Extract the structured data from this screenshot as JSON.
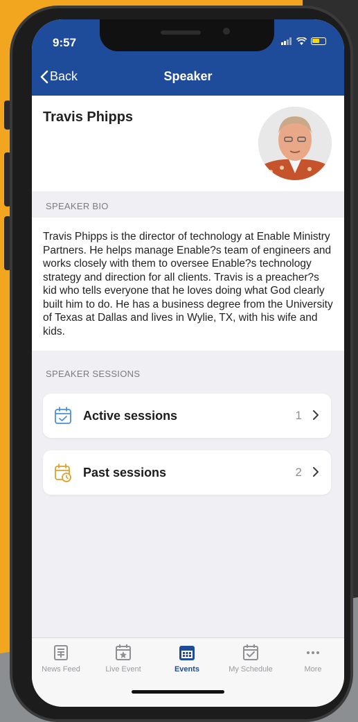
{
  "status": {
    "time": "9:57"
  },
  "nav": {
    "back": "Back",
    "title": "Speaker"
  },
  "speaker": {
    "name": "Travis Phipps",
    "bio_label": "SPEAKER BIO",
    "bio": "Travis Phipps is the director of technology at Enable Ministry Partners. He helps manage Enable?s team of engineers and works closely with them to oversee Enable?s technology strategy and direction for all clients. Travis is a preacher?s kid who tells everyone that he loves doing what God clearly built him to do. He has a business degree from the University of Texas at Dallas and lives in Wylie, TX, with his wife and kids.",
    "sessions_label": "SPEAKER SESSIONS"
  },
  "sessions": {
    "active": {
      "label": "Active sessions",
      "count": "1",
      "icon": "calendar-check-icon",
      "color": "#4a90d9"
    },
    "past": {
      "label": "Past sessions",
      "count": "2",
      "icon": "calendar-clock-icon",
      "color": "#e2a02a"
    }
  },
  "tabs": [
    {
      "label": "News Feed",
      "icon": "newspaper-icon"
    },
    {
      "label": "Live Event",
      "icon": "calendar-star-icon"
    },
    {
      "label": "Events",
      "icon": "calendar-grid-icon"
    },
    {
      "label": "My Schedule",
      "icon": "calendar-check-icon"
    },
    {
      "label": "More",
      "icon": "more-dots-icon"
    }
  ],
  "colors": {
    "primary": "#1e4c9a",
    "background": "#efeff4"
  }
}
